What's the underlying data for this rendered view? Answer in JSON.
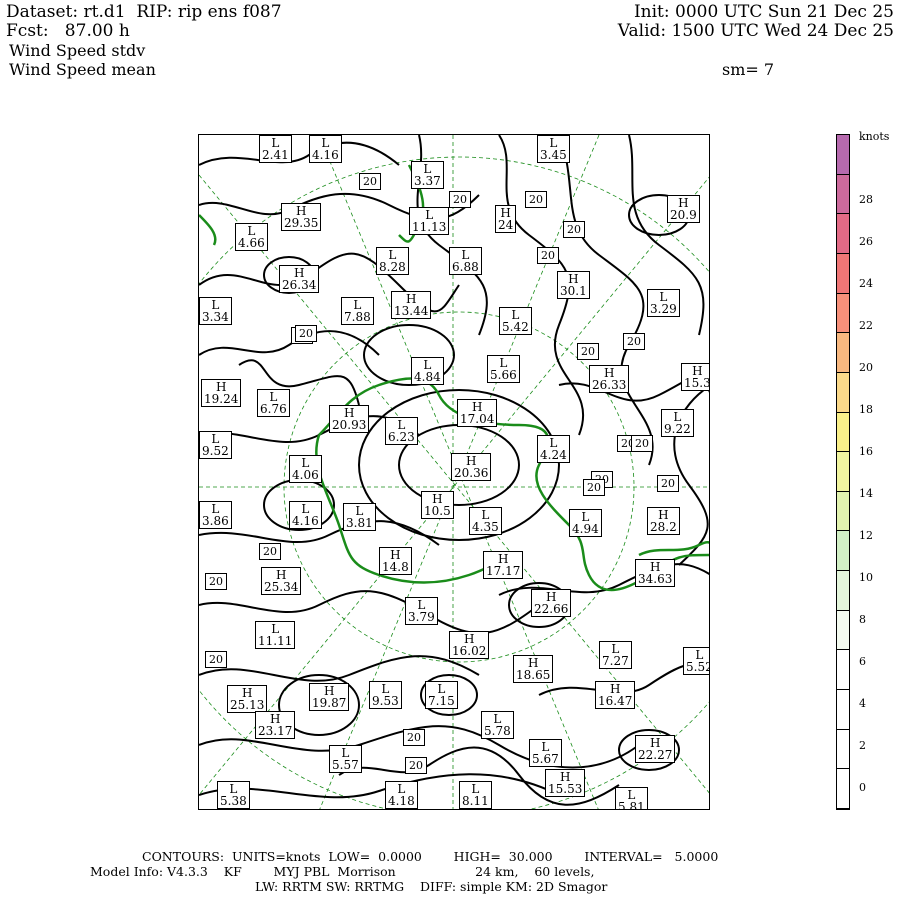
{
  "header": {
    "dataset": "Dataset: rt.d1  RIP: rip ens f087",
    "fcst": "Fcst:   87.00 h",
    "line3": "Wind Speed stdv",
    "line4": "Wind Speed mean",
    "init": "Init: 0000 UTC Sun 21 Dec 25",
    "valid": "Valid: 1500 UTC Wed 24 Dec 25",
    "smooth": "sm= 7"
  },
  "colorbar": {
    "units": "knots",
    "labels": [
      "0",
      "2",
      "4",
      "6",
      "8",
      "10",
      "12",
      "14",
      "16",
      "18",
      "20",
      "22",
      "24",
      "26",
      "28"
    ],
    "colors": [
      "#ffffff",
      "#ffffff",
      "#ffffff",
      "#ffffff",
      "#f4fbf0",
      "#e4f6dc",
      "#d2f0c6",
      "#e2f3b0",
      "#f1f5a0",
      "#faf08a",
      "#fbd98a",
      "#f8b880",
      "#f7907a",
      "#f07676",
      "#e26a86",
      "#cc6a9c",
      "#b66aae"
    ]
  },
  "footer": {
    "line1": "CONTOURS:  UNITS=knots  LOW=  0.0000        HIGH=  30.000        INTERVAL=   5.0000",
    "line2": "Model Info: V4.3.3    KF        MYJ PBL  Morrison                    24 km,    60 levels,",
    "line3": "LW: RRTM SW: RRTMG    DIFF: simple KM: 2D Smagor"
  },
  "extrema": [
    {
      "k": "L",
      "v": "2.41"
    },
    {
      "k": "L",
      "v": "4.16"
    },
    {
      "k": "L",
      "v": "3.37"
    },
    {
      "k": "L",
      "v": "3.45"
    },
    {
      "k": "H",
      "v": "20.9"
    },
    {
      "k": "H",
      "v": "29.35"
    },
    {
      "k": "L",
      "v": "4.66"
    },
    {
      "k": "L",
      "v": "11.13"
    },
    {
      "k": "H",
      "v": "24"
    },
    {
      "k": "L",
      "v": "8.28"
    },
    {
      "k": "L",
      "v": "6.88"
    },
    {
      "k": "H",
      "v": "30.1"
    },
    {
      "k": "H",
      "v": "26.34"
    },
    {
      "k": "L",
      "v": "3.34"
    },
    {
      "k": "L",
      "v": "7.88"
    },
    {
      "k": "H",
      "v": "13.44"
    },
    {
      "k": "L",
      "v": "5.42"
    },
    {
      "k": "L",
      "v": "3.29"
    },
    {
      "k": "L",
      "v": "4.84"
    },
    {
      "k": "L",
      "v": "5.66"
    },
    {
      "k": "H",
      "v": "26.33"
    },
    {
      "k": "H",
      "v": "15.3"
    },
    {
      "k": "H",
      "v": "19.24"
    },
    {
      "k": "L",
      "v": "6.76"
    },
    {
      "k": "H",
      "v": "20.93"
    },
    {
      "k": "L",
      "v": "6.23"
    },
    {
      "k": "H",
      "v": "17.04"
    },
    {
      "k": "L",
      "v": "9.22"
    },
    {
      "k": "L",
      "v": "9.52"
    },
    {
      "k": "L",
      "v": "4.24"
    },
    {
      "k": "H",
      "v": "20.36"
    },
    {
      "k": "L",
      "v": "4.06"
    },
    {
      "k": "H",
      "v": "10.5"
    },
    {
      "k": "L",
      "v": "3.86"
    },
    {
      "k": "L",
      "v": "4.16"
    },
    {
      "k": "L",
      "v": "3.81"
    },
    {
      "k": "L",
      "v": "4.35"
    },
    {
      "k": "L",
      "v": "4.94"
    },
    {
      "k": "H",
      "v": "28.2"
    },
    {
      "k": "H",
      "v": "14.8"
    },
    {
      "k": "H",
      "v": "17.17"
    },
    {
      "k": "H",
      "v": "34.63"
    },
    {
      "k": "H",
      "v": "25.34"
    },
    {
      "k": "L",
      "v": "3.79"
    },
    {
      "k": "H",
      "v": "22.66"
    },
    {
      "k": "L",
      "v": "11.11"
    },
    {
      "k": "H",
      "v": "16.02"
    },
    {
      "k": "L",
      "v": "7.27"
    },
    {
      "k": "L",
      "v": "5.52"
    },
    {
      "k": "H",
      "v": "18.65"
    },
    {
      "k": "H",
      "v": "25.13"
    },
    {
      "k": "H",
      "v": "19.87"
    },
    {
      "k": "L",
      "v": "9.53"
    },
    {
      "k": "L",
      "v": "7.15"
    },
    {
      "k": "H",
      "v": "16.47"
    },
    {
      "k": "L",
      "v": "5.78"
    },
    {
      "k": "H",
      "v": "23.17"
    },
    {
      "k": "L",
      "v": "5.67"
    },
    {
      "k": "H",
      "v": "22.27"
    },
    {
      "k": "L",
      "v": "5.57"
    },
    {
      "k": "L",
      "v": "5.38"
    },
    {
      "k": "L",
      "v": "4.18"
    },
    {
      "k": "L",
      "v": "8.11"
    },
    {
      "k": "H",
      "v": "15.53"
    },
    {
      "k": "L",
      "v": "5.81"
    }
  ],
  "contour_labels": [
    "20",
    "20",
    "20",
    "20",
    "20",
    "20",
    "20",
    "20",
    "20",
    "20",
    "20",
    "20",
    "20",
    "20",
    "20",
    "20",
    "20",
    "20",
    "20"
  ]
}
